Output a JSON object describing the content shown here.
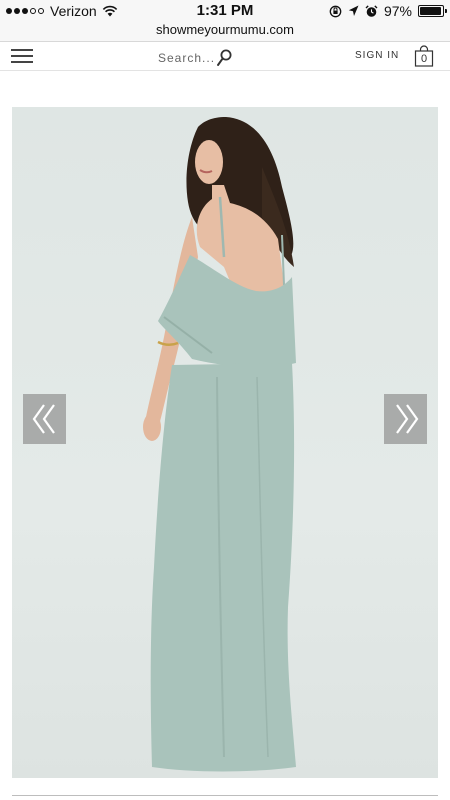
{
  "status_bar": {
    "carrier": "Verizon",
    "time": "1:31 PM",
    "battery_percent": "97%",
    "battery_level": 0.97,
    "signal_bars_filled": 3,
    "signal_bars_total": 5
  },
  "browser": {
    "url": "showmeyourmumu.com"
  },
  "header": {
    "search_placeholder": "Search...",
    "sign_in_label": "SIGN IN",
    "cart_count": "0"
  },
  "product": {
    "dress_color": "#a9c3bb",
    "background_color": "#e2e8e6"
  },
  "icons": {
    "menu": "hamburger-icon",
    "search": "search-icon",
    "cart": "shopping-bag-icon",
    "prev": "double-chevron-left-icon",
    "next": "double-chevron-right-icon"
  }
}
